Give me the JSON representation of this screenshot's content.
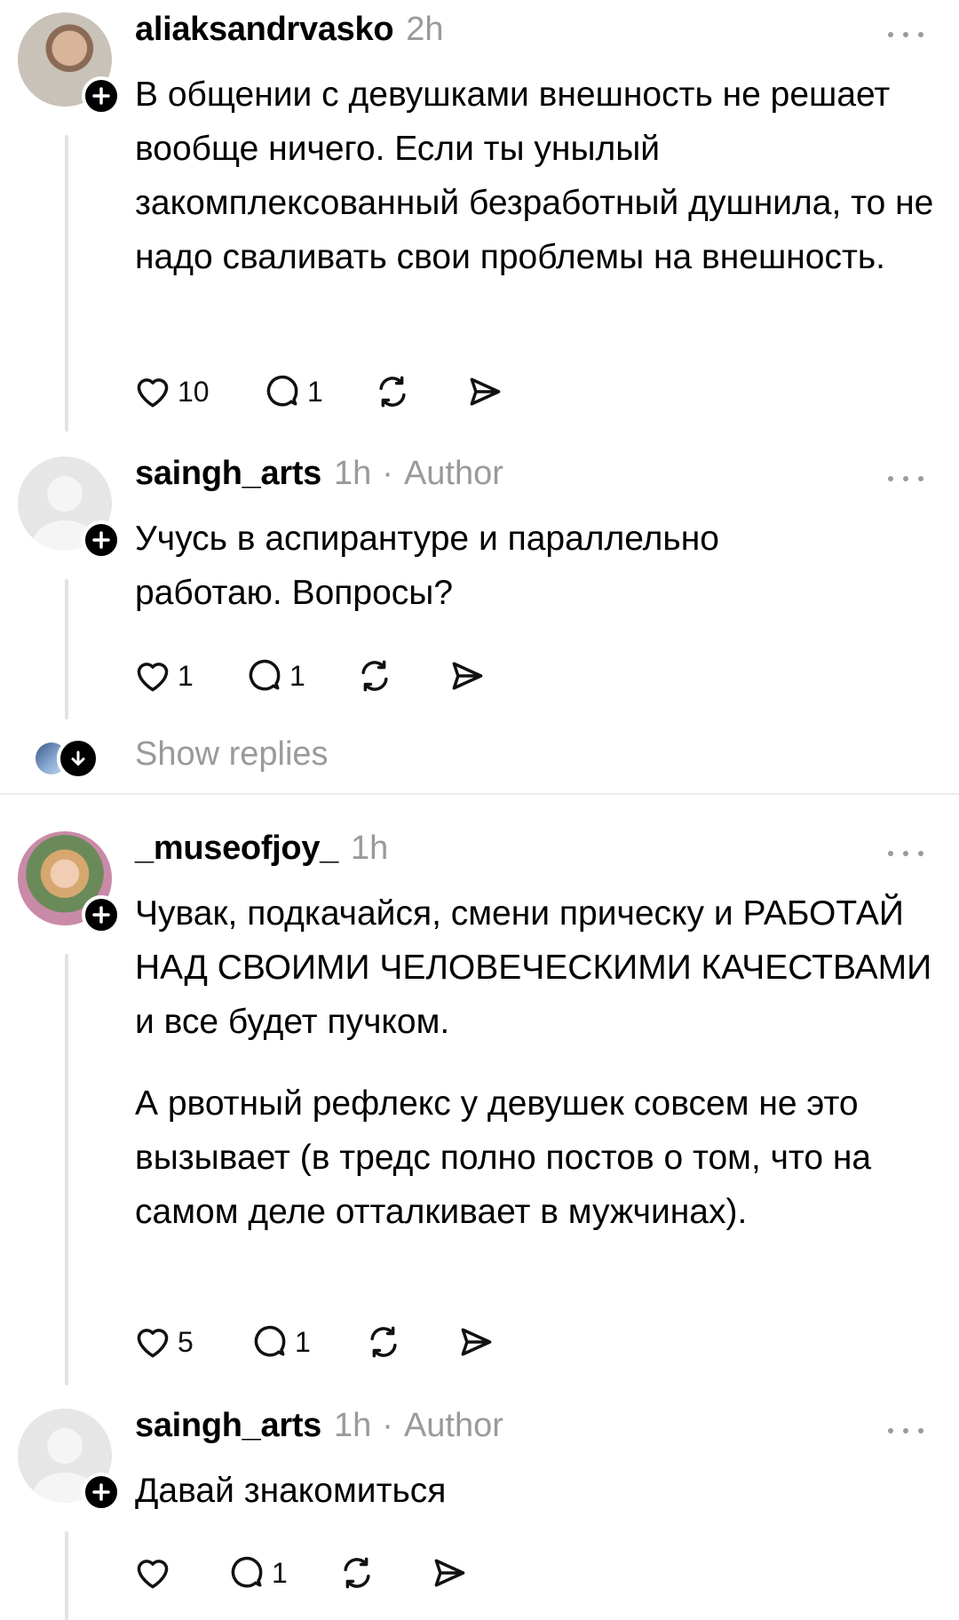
{
  "posts": [
    {
      "username": "aliaksandrvasko",
      "time": "2h",
      "author_tag": "",
      "paragraphs": [
        "В общении с девушками внешность не решает вообще ничего. Если ты унылый закомплексованный безработный душнила, то не надо сваливать свои проблемы на внешность."
      ],
      "likes": "10",
      "replies": "1"
    },
    {
      "username": "saingh_arts",
      "time": "1h",
      "author_tag": "Author",
      "paragraphs": [
        "Учусь в аспирантуре и параллельно работаю. Вопросы?"
      ],
      "likes": "1",
      "replies": "1"
    },
    {
      "username": "_museofjoy_",
      "time": "1h",
      "author_tag": "",
      "paragraphs": [
        "Чувак, подкачайся, смени прическу и РАБОТАЙ НАД СВОИМИ ЧЕЛОВЕЧЕСКИМИ КАЧЕСТВАМИ и все будет пучком.",
        "А рвотный рефлекс у девушек совсем не это вызывает (в тредс полно постов о том, что на самом деле отталкивает в мужчинах)."
      ],
      "likes": "5",
      "replies": "1"
    },
    {
      "username": "saingh_arts",
      "time": "1h",
      "author_tag": "Author",
      "paragraphs": [
        "Давай знакомиться"
      ],
      "likes": "",
      "replies": "1"
    }
  ],
  "show_replies_label": "Show replies",
  "dot_separator": "·",
  "colors": {
    "text": "#000000",
    "muted": "#9a9a9a",
    "thread_line": "#e3e3e3",
    "divider": "#ececec"
  },
  "icons": [
    "heart-icon",
    "comment-icon",
    "repost-icon",
    "share-icon",
    "more-icon",
    "follow-plus-icon",
    "chevron-down-icon"
  ]
}
